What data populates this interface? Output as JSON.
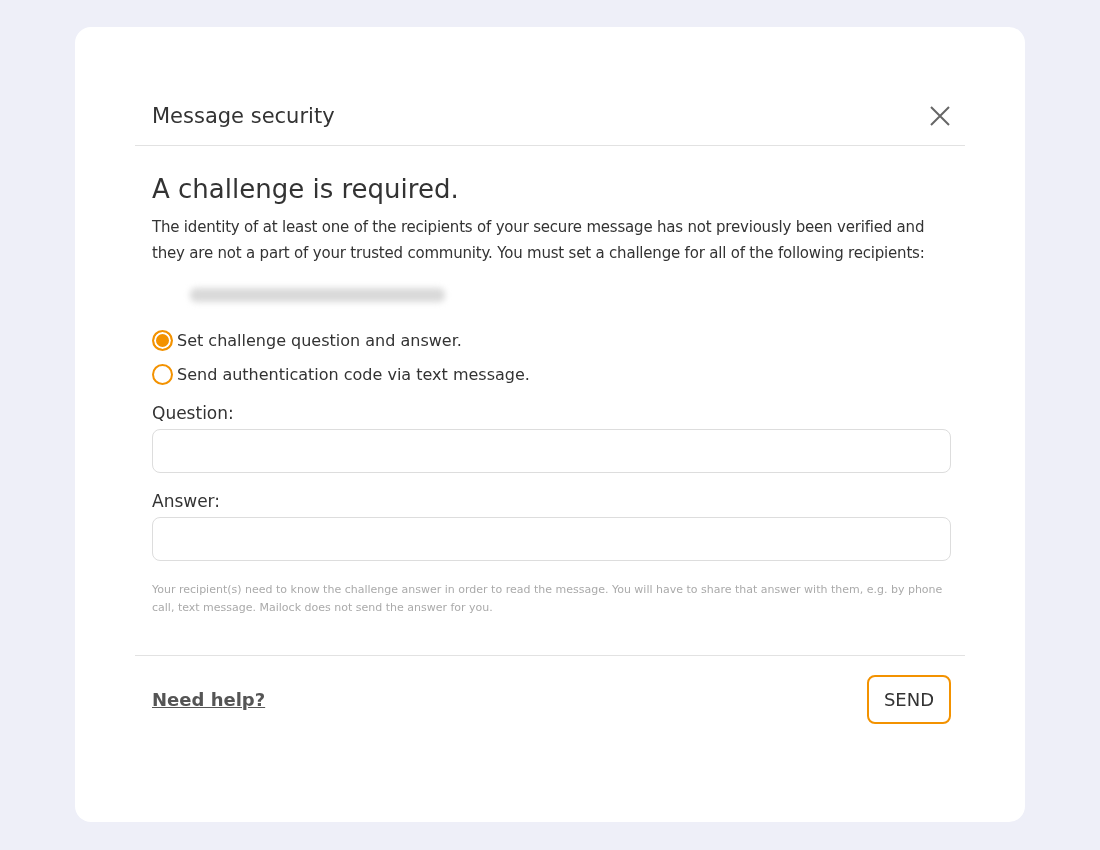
{
  "dialog": {
    "title": "Message security"
  },
  "heading": "A challenge is required.",
  "description": "The identity of at least one of the recipients of your secure message has not previously been verified and they are not a part of your trusted community. You must set a challenge for all of the following recipients:",
  "options": [
    {
      "label": "Set challenge question and answer.",
      "selected": true
    },
    {
      "label": "Send authentication code via text message.",
      "selected": false
    }
  ],
  "fields": [
    {
      "label": "Question:"
    },
    {
      "label": "Answer:"
    }
  ],
  "note": "Your recipient(s) need to know the challenge answer in order to read the message. You will have to share that answer with them, e.g. by phone call, text message. Mailock does not send the answer for you.",
  "footer": {
    "help_link": "Need help?",
    "send_button": "SEND"
  }
}
